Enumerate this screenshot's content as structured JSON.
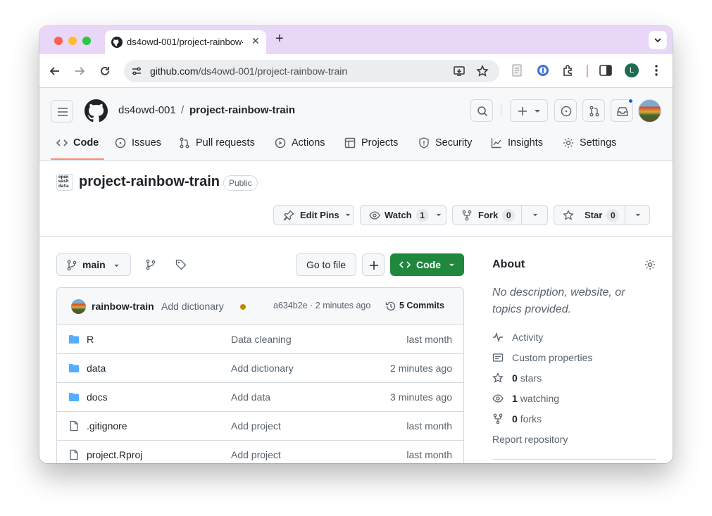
{
  "browser": {
    "tab_title": "ds4owd-001/project-rainbow-train",
    "url_host": "github.com",
    "url_path": "/ds4owd-001/project-rainbow-train",
    "profile_initial": "L",
    "colors": {
      "tabstrip": "#e8d7f6",
      "close": "#ff5f57",
      "minimize": "#febc2e",
      "zoom": "#28c840",
      "profile": "#1e6b52"
    }
  },
  "header": {
    "owner": "ds4owd-001",
    "separator": "/",
    "repo": "project-rainbow-train"
  },
  "nav": {
    "code": "Code",
    "issues": "Issues",
    "pull_requests": "Pull requests",
    "actions": "Actions",
    "projects": "Projects",
    "security": "Security",
    "insights": "Insights",
    "settings": "Settings"
  },
  "repo": {
    "logo_text": "open wash data",
    "title": "project-rainbow-train",
    "visibility": "Public",
    "edit_pins": "Edit Pins",
    "watch": "Watch",
    "watch_count": "1",
    "fork": "Fork",
    "fork_count": "0",
    "star": "Star",
    "star_count": "0"
  },
  "toolbar": {
    "branch": "main",
    "goto_file": "Go to file",
    "code_button": "Code"
  },
  "commit": {
    "author": "rainbow-train",
    "message": "Add dictionary",
    "hash_time": "a634b2e · 2 minutes ago",
    "commits": "5 Commits",
    "status_color": "#bf8700"
  },
  "files": [
    {
      "name": "R",
      "type": "folder",
      "message": "Data cleaning",
      "time": "last month"
    },
    {
      "name": "data",
      "type": "folder",
      "message": "Add dictionary",
      "time": "2 minutes ago"
    },
    {
      "name": "docs",
      "type": "folder",
      "message": "Add data",
      "time": "3 minutes ago"
    },
    {
      "name": ".gitignore",
      "type": "file",
      "message": "Add project",
      "time": "last month"
    },
    {
      "name": "project.Rproj",
      "type": "file",
      "message": "Add project",
      "time": "last month"
    }
  ],
  "about": {
    "title": "About",
    "description": "No description, website, or topics provided.",
    "activity": "Activity",
    "custom_properties": "Custom properties",
    "stars_count": "0",
    "stars_label": "stars",
    "watching_count": "1",
    "watching_label": "watching",
    "forks_count": "0",
    "forks_label": "forks",
    "report": "Report repository"
  }
}
